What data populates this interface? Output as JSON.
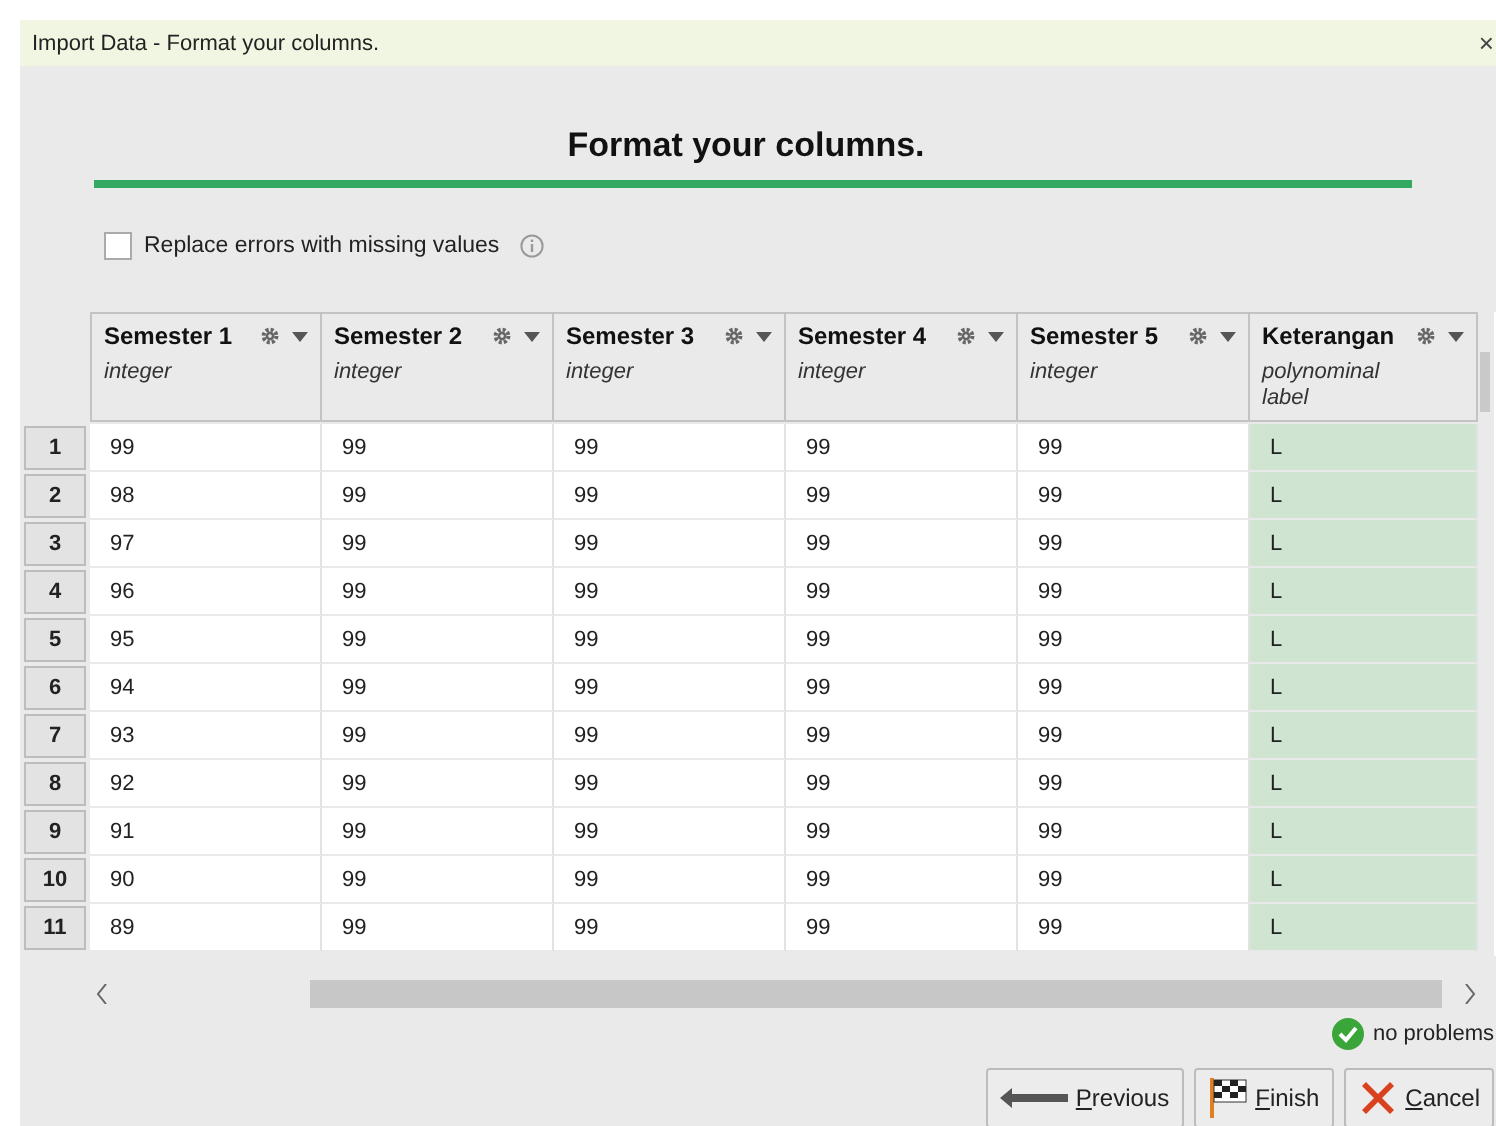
{
  "window": {
    "title": "Import Data - Format your columns.",
    "close": "×"
  },
  "heading": "Format your columns.",
  "replace_errors": {
    "label": "Replace errors with missing values",
    "checked": false
  },
  "table": {
    "columns": [
      {
        "name": "Semester 1",
        "type": "integer"
      },
      {
        "name": "Semester 2",
        "type": "integer"
      },
      {
        "name": "Semester 3",
        "type": "integer"
      },
      {
        "name": "Semester 4",
        "type": "integer"
      },
      {
        "name": "Semester 5",
        "type": "integer"
      },
      {
        "name": "Keterangan",
        "type": "polynominal",
        "role": "label"
      }
    ],
    "rows": [
      {
        "index": "1",
        "cells": [
          "99",
          "99",
          "99",
          "99",
          "99",
          "L"
        ]
      },
      {
        "index": "2",
        "cells": [
          "98",
          "99",
          "99",
          "99",
          "99",
          "L"
        ]
      },
      {
        "index": "3",
        "cells": [
          "97",
          "99",
          "99",
          "99",
          "99",
          "L"
        ]
      },
      {
        "index": "4",
        "cells": [
          "96",
          "99",
          "99",
          "99",
          "99",
          "L"
        ]
      },
      {
        "index": "5",
        "cells": [
          "95",
          "99",
          "99",
          "99",
          "99",
          "L"
        ]
      },
      {
        "index": "6",
        "cells": [
          "94",
          "99",
          "99",
          "99",
          "99",
          "L"
        ]
      },
      {
        "index": "7",
        "cells": [
          "93",
          "99",
          "99",
          "99",
          "99",
          "L"
        ]
      },
      {
        "index": "8",
        "cells": [
          "92",
          "99",
          "99",
          "99",
          "99",
          "L"
        ]
      },
      {
        "index": "9",
        "cells": [
          "91",
          "99",
          "99",
          "99",
          "99",
          "L"
        ]
      },
      {
        "index": "10",
        "cells": [
          "90",
          "99",
          "99",
          "99",
          "99",
          "L"
        ]
      },
      {
        "index": "11",
        "cells": [
          "89",
          "99",
          "99",
          "99",
          "99",
          "L"
        ]
      }
    ]
  },
  "status": "no problems",
  "buttons": [
    {
      "kind": "previous",
      "label": "Previous"
    },
    {
      "kind": "finish",
      "label": "Finish"
    },
    {
      "kind": "cancel",
      "label": "Cancel"
    }
  ]
}
